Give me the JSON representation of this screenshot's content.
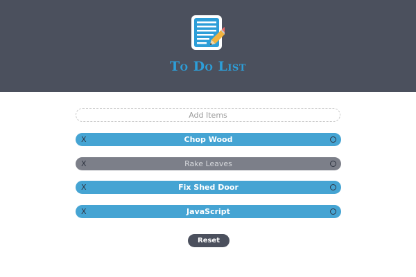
{
  "app": {
    "title": "To Do List",
    "logo_icon": "notepad-pencil-icon"
  },
  "add": {
    "placeholder": "Add Items",
    "value": ""
  },
  "todos": [
    {
      "label": "Chop Wood",
      "status": "active",
      "delete_glyph": "X"
    },
    {
      "label": "Rake Leaves",
      "status": "done",
      "delete_glyph": "X"
    },
    {
      "label": "Fix Shed Door",
      "status": "active",
      "delete_glyph": "X"
    },
    {
      "label": "JavaScript",
      "status": "active",
      "delete_glyph": "X"
    }
  ],
  "actions": {
    "reset_label": "Reset"
  },
  "colors": {
    "header_bg": "#4b505d",
    "accent": "#2d9ed8",
    "active_item": "#45a4d3",
    "done_item": "#7c7f89"
  }
}
